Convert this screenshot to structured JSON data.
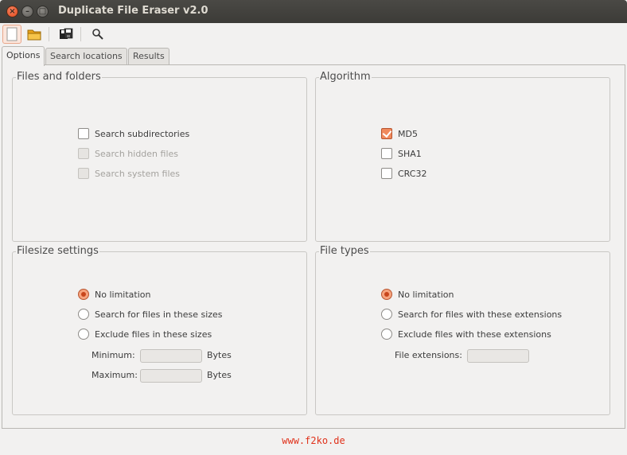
{
  "window": {
    "title": "Duplicate File Eraser v2.0",
    "close_glyph": "×",
    "minimize_glyph": "–",
    "maximize_glyph": "□"
  },
  "toolbar": {
    "icons": [
      "new-document-icon",
      "open-folder-icon",
      "save-icon",
      "search-icon"
    ]
  },
  "tabs": [
    {
      "label": "Options",
      "active": true
    },
    {
      "label": "Search locations",
      "active": false
    },
    {
      "label": "Results",
      "active": false
    }
  ],
  "files_and_folders": {
    "title": "Files and folders",
    "options": [
      {
        "label": "Search subdirectories",
        "checked": false,
        "enabled": true
      },
      {
        "label": "Search hidden files",
        "checked": false,
        "enabled": false
      },
      {
        "label": "Search system files",
        "checked": false,
        "enabled": false
      }
    ]
  },
  "algorithm": {
    "title": "Algorithm",
    "options": [
      {
        "label": "MD5",
        "checked": true
      },
      {
        "label": "SHA1",
        "checked": false
      },
      {
        "label": "CRC32",
        "checked": false
      }
    ]
  },
  "filesize": {
    "title": "Filesize settings",
    "options": [
      {
        "label": "No limitation",
        "selected": true
      },
      {
        "label": "Search for files in these sizes",
        "selected": false
      },
      {
        "label": "Exclude files in these sizes",
        "selected": false
      }
    ],
    "minimum_label": "Minimum:",
    "minimum_value": "",
    "maximum_label": "Maximum:",
    "maximum_value": "",
    "unit": "Bytes"
  },
  "file_types": {
    "title": "File types",
    "options": [
      {
        "label": "No limitation",
        "selected": true
      },
      {
        "label": "Search for files with these extensions",
        "selected": false
      },
      {
        "label": "Exclude files with these extensions",
        "selected": false
      }
    ],
    "extensions_label": "File extensions:",
    "extensions_value": ""
  },
  "footer": {
    "text": "www.f2ko.de"
  },
  "colors": {
    "accent": "#f08a5d",
    "footer_link": "#e0321b",
    "titlebar": "#3c3b37"
  }
}
